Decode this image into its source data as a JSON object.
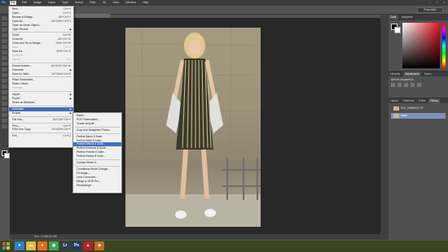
{
  "app": {
    "logo": "Ps"
  },
  "menubar": {
    "items": [
      "File",
      "Edit",
      "Image",
      "Layer",
      "Type",
      "Select",
      "Filter",
      "3D",
      "View",
      "Window",
      "Help"
    ],
    "active_index": 0
  },
  "options": {
    "workspace": "Essentials"
  },
  "document": {
    "tab_title": "",
    "status": "Doc: 10.5M/10.5M"
  },
  "file_menu": {
    "items": [
      {
        "label": "New...",
        "shortcut": "Ctrl+N",
        "disabled": false
      },
      {
        "label": "Open...",
        "shortcut": "Ctrl+O",
        "disabled": false
      },
      {
        "label": "Browse in Bridge...",
        "shortcut": "Alt+Ctrl+O",
        "disabled": false
      },
      {
        "label": "Open As...",
        "shortcut": "Alt+Shift+Ctrl+O",
        "disabled": false
      },
      {
        "label": "Open as Smart Object...",
        "shortcut": "",
        "disabled": false
      },
      {
        "label": "Open Recent",
        "shortcut": "",
        "disabled": false,
        "submenu": true
      },
      {
        "sep": true
      },
      {
        "label": "Close",
        "shortcut": "Ctrl+W",
        "disabled": false
      },
      {
        "label": "Close All",
        "shortcut": "Alt+Ctrl+W",
        "disabled": false
      },
      {
        "label": "Close and Go to Bridge...",
        "shortcut": "Shift+Ctrl+W",
        "disabled": false
      },
      {
        "label": "Save",
        "shortcut": "Ctrl+S",
        "disabled": true
      },
      {
        "label": "Save As...",
        "shortcut": "Shift+Ctrl+S",
        "disabled": false
      },
      {
        "label": "Check In...",
        "shortcut": "",
        "disabled": true
      },
      {
        "label": "Revert",
        "shortcut": "F12",
        "disabled": true
      },
      {
        "sep": true
      },
      {
        "label": "Extract Assets...",
        "shortcut": "Alt+Shift+Ctrl+W",
        "disabled": false
      },
      {
        "label": "Generate",
        "shortcut": "",
        "disabled": false,
        "submenu": true
      },
      {
        "label": "Save for Web...",
        "shortcut": "Alt+Shift+Ctrl+S",
        "disabled": false
      },
      {
        "sep": true
      },
      {
        "label": "Place Embedded...",
        "shortcut": "",
        "disabled": false
      },
      {
        "label": "Place Linked...",
        "shortcut": "",
        "disabled": false
      },
      {
        "label": "Package...",
        "shortcut": "",
        "disabled": true
      },
      {
        "sep": true
      },
      {
        "label": "Import",
        "shortcut": "",
        "disabled": false,
        "submenu": true
      },
      {
        "label": "Export",
        "shortcut": "",
        "disabled": false,
        "submenu": true
      },
      {
        "label": "Share on Behance...",
        "shortcut": "",
        "disabled": false
      },
      {
        "sep": true
      },
      {
        "label": "Automate",
        "shortcut": "",
        "disabled": false,
        "submenu": true,
        "highlighted": true
      },
      {
        "label": "Scripts",
        "shortcut": "",
        "disabled": false,
        "submenu": true
      },
      {
        "sep": true
      },
      {
        "label": "File Info...",
        "shortcut": "Alt+Shift+Ctrl+I",
        "disabled": false
      },
      {
        "sep": true
      },
      {
        "label": "Print...",
        "shortcut": "Ctrl+P",
        "disabled": false
      },
      {
        "label": "Print One Copy",
        "shortcut": "Alt+Shift+Ctrl+P",
        "disabled": false
      },
      {
        "sep": true
      },
      {
        "label": "Exit",
        "shortcut": "Ctrl+Q",
        "disabled": false
      }
    ]
  },
  "automate_menu": {
    "items": [
      {
        "label": "Batch..."
      },
      {
        "label": "PDF Presentation..."
      },
      {
        "label": "Create Droplet..."
      },
      {
        "sep": true
      },
      {
        "label": "Crop and Straighten Photos"
      },
      {
        "sep": true
      },
      {
        "label": "Perfect Batch 8 Suite..."
      },
      {
        "label": "Perfect B&W 8 Suite..."
      },
      {
        "label": "Perfect Effects 8 Suite...",
        "highlighted": true
      },
      {
        "label": "Perfect Enhance 8 Suite..."
      },
      {
        "label": "Perfect Portrait 8 Suite..."
      },
      {
        "label": "Perfect Resize 8 Suite..."
      },
      {
        "sep": true
      },
      {
        "label": "Contact Sheet II..."
      },
      {
        "sep": true
      },
      {
        "label": "Conditional Mode Change..."
      },
      {
        "label": "Fit Image..."
      },
      {
        "label": "Lens Correction..."
      },
      {
        "label": "Merge to HDR Pro..."
      },
      {
        "label": "Photomerge..."
      }
    ]
  },
  "panels": {
    "color_tabs": [
      "Color",
      "Swatches"
    ],
    "adjust_tabs": [
      "Libraries",
      "Adjustments",
      "Styles"
    ],
    "adjust_label": "Add an adjustment",
    "layers_tabs": [
      "Layers",
      "Channels",
      "Paths",
      "History"
    ],
    "layers": [
      {
        "name": "IMG_9988BKS.TIF",
        "selected": false
      },
      {
        "name": "Open",
        "selected": true
      }
    ]
  },
  "taskbar": {
    "apps": [
      {
        "name": "ie",
        "glyph": "e",
        "color": "#2e7fd6"
      },
      {
        "name": "explorer",
        "glyph": "▬",
        "color": "#e3b94a"
      },
      {
        "name": "firefox",
        "glyph": "●",
        "color": "#e86b1e"
      },
      {
        "name": "chrome",
        "glyph": "◉",
        "color": "#3aa655"
      },
      {
        "name": "lightroom",
        "glyph": "Lr",
        "color": "#2d3f55"
      },
      {
        "name": "photoshop",
        "glyph": "Ps",
        "color": "#1d3f66"
      },
      {
        "name": "app-red",
        "glyph": "▲",
        "color": "#b8202c"
      },
      {
        "name": "app-orange",
        "glyph": "◆",
        "color": "#c86a1a"
      }
    ],
    "clock": "",
    "date": ""
  }
}
